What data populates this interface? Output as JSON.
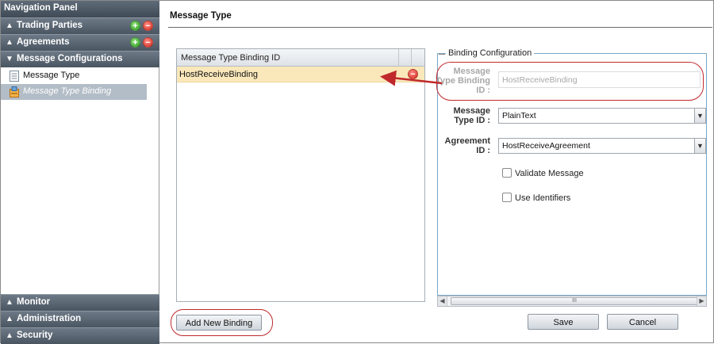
{
  "sidebar": {
    "title": "Navigation Panel",
    "sections": [
      {
        "label": "Trading Parties",
        "chevron": "^",
        "has_actions": true
      },
      {
        "label": "Agreements",
        "chevron": "^",
        "has_actions": true
      },
      {
        "label": "Message Configurations",
        "chevron": "v",
        "has_actions": false
      }
    ],
    "items": [
      {
        "label": "Message Type",
        "icon": "document-icon",
        "selected": false
      },
      {
        "label": "Message Type Binding",
        "icon": "binding-icon",
        "selected": true
      }
    ],
    "bottom_sections": [
      {
        "label": "Monitor",
        "chevron": "^"
      },
      {
        "label": "Administration",
        "chevron": "^"
      },
      {
        "label": "Security",
        "chevron": "^"
      }
    ],
    "add_glyph": "+",
    "remove_glyph": "−"
  },
  "main": {
    "title": "Message Type",
    "grid": {
      "header": "Message Type Binding ID",
      "rows": [
        "HostReceiveBinding"
      ]
    },
    "config": {
      "legend": "Binding Configuration",
      "binding_id_label": "Message Type Binding ID :",
      "binding_id_value": "HostReceiveBinding",
      "message_type_label": "Message Type ID :",
      "message_type_value": "PlainText",
      "agreement_label": "Agreement ID :",
      "agreement_value": "HostReceiveAgreement",
      "validate_label": "Validate Message",
      "identifiers_label": "Use Identifiers"
    },
    "scroll_thumb_glyph": "III",
    "buttons": {
      "add_binding": "Add New Binding",
      "save": "Save",
      "cancel": "Cancel"
    }
  },
  "colors": {
    "header_gradient_top": "#6d7986",
    "header_gradient_bottom": "#4a5562",
    "selected_item": "#b3bdc7",
    "selected_row": "#fae8bb",
    "annotation": "#c0292c",
    "fieldset_border": "#7aa7c7"
  }
}
